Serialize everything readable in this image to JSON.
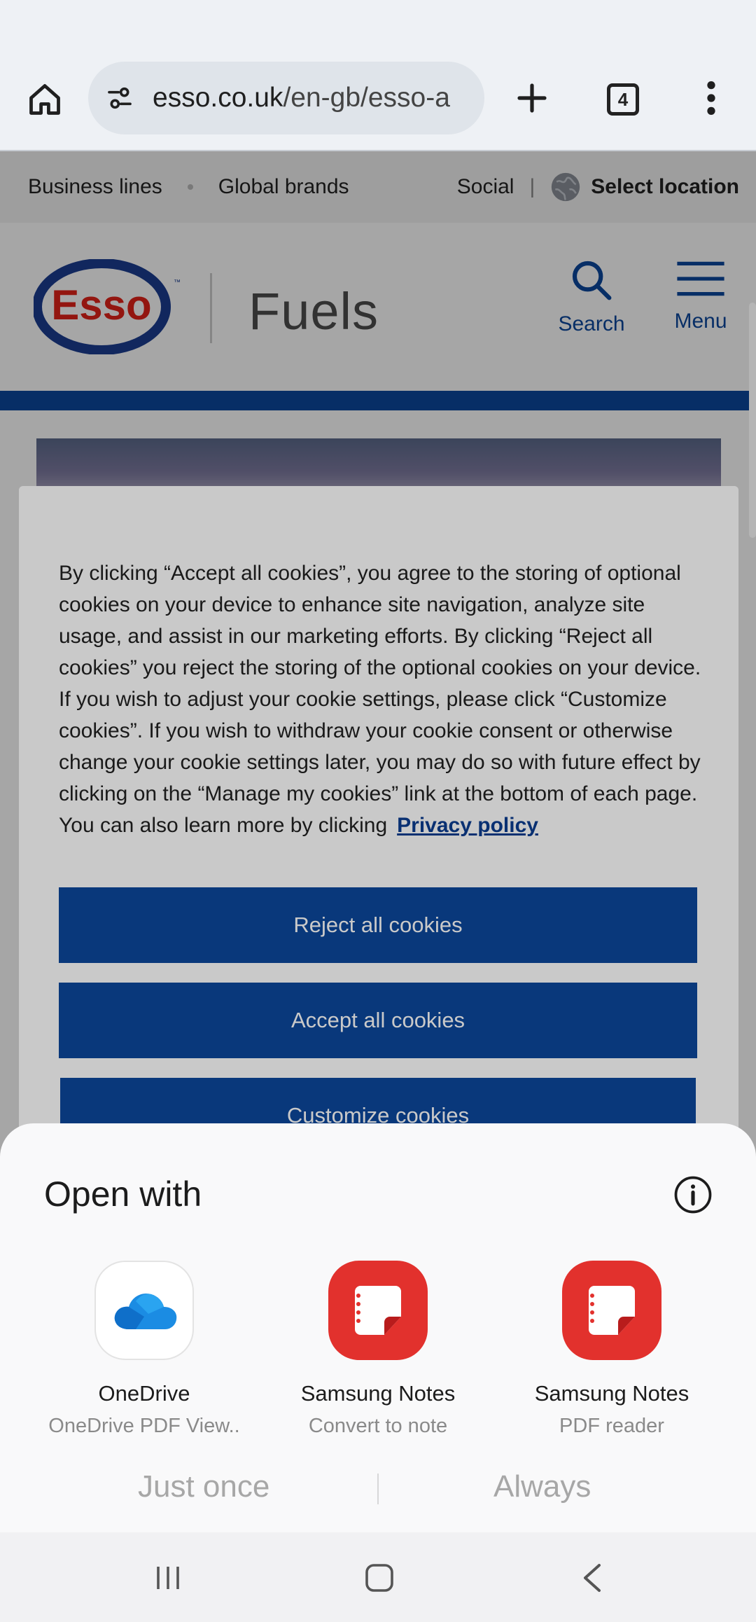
{
  "browser": {
    "url_domain": "esso.co.uk",
    "url_path": "/en-gb/esso-a",
    "tab_count": "4",
    "icons": [
      "home-icon",
      "site-settings-icon",
      "new-tab-icon",
      "tab-switcher-icon",
      "more-options-icon"
    ]
  },
  "site": {
    "utility_nav": {
      "business_lines": "Business lines",
      "global_brands": "Global brands",
      "social": "Social",
      "separator": "|",
      "select_location": "Select location"
    },
    "logo_text": "Esso",
    "brand_name": "Fuels",
    "search_label": "Search",
    "menu_label": "Menu",
    "accent_color": "#0c479d",
    "logo_red": "#e2231a"
  },
  "cookie_banner": {
    "body": "By clicking “Accept all cookies”, you agree to the storing of optional cookies on your device to enhance site navigation, analyze site usage, and assist in our marketing efforts. By clicking “Reject all cookies” you reject the storing of the optional cookies on your device. If you wish to adjust your cookie settings, please click “Customize cookies”. If you wish to withdraw your cookie consent or otherwise change your cookie settings later, you may do so with future effect by clicking on the “Manage my cookies” link at the bottom of each page. You can also learn more by clicking",
    "privacy_link": "Privacy policy",
    "reject_label": "Reject all cookies",
    "accept_label": "Accept all cookies",
    "customize_label": "Customize cookies"
  },
  "open_with": {
    "title": "Open with",
    "apps": [
      {
        "name": "OneDrive",
        "subtitle": "OneDrive PDF View..",
        "icon": "onedrive-icon"
      },
      {
        "name": "Samsung Notes",
        "subtitle": "Convert to note",
        "icon": "samsung-notes-icon"
      },
      {
        "name": "Samsung Notes",
        "subtitle": "PDF reader",
        "icon": "samsung-notes-icon"
      }
    ],
    "just_once_label": "Just once",
    "always_label": "Always"
  },
  "system_nav": {
    "icons": [
      "recents-icon",
      "home-nav-icon",
      "back-icon"
    ]
  }
}
